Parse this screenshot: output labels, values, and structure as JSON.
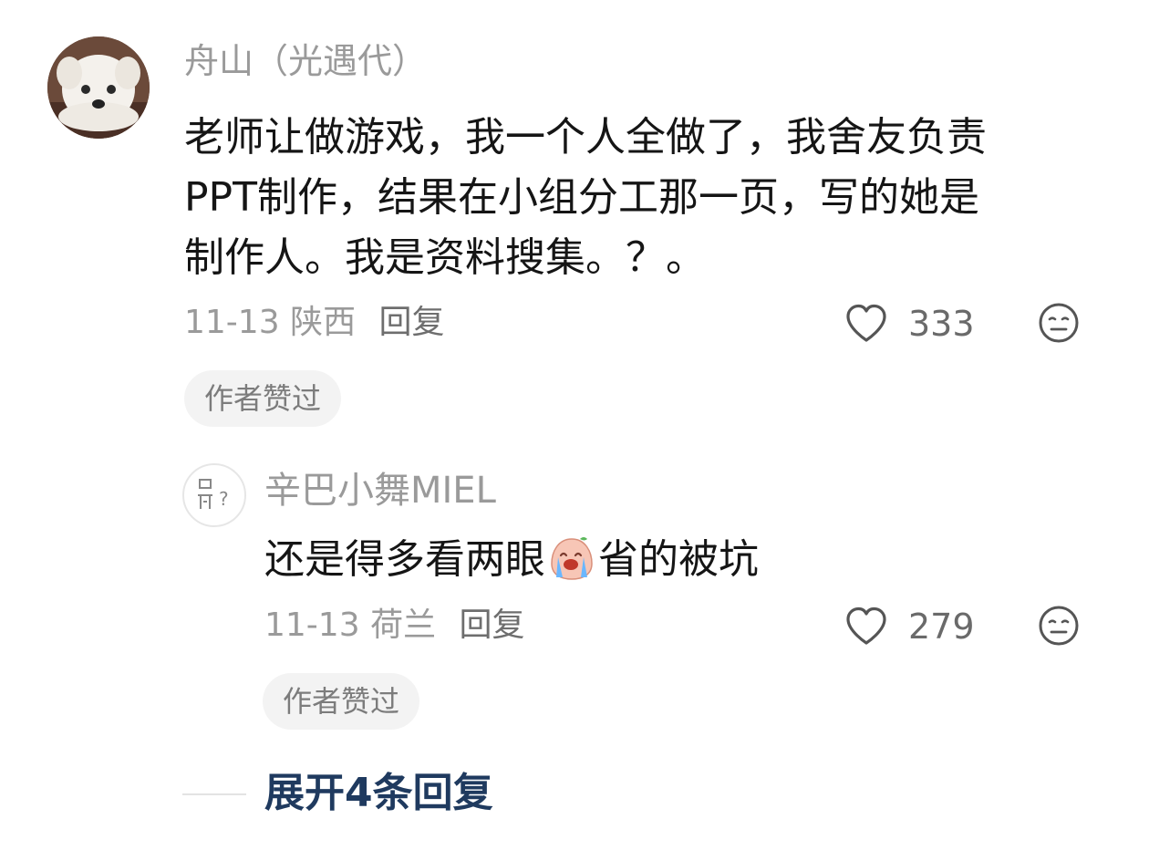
{
  "comment": {
    "username": "舟山（光遇代）",
    "text": "老师让做游戏，我一个人全做了，我舍友负责PPT制作，结果在小组分工那一页，写的她是制作人。我是资料搜集。？。",
    "lines": [
      "老师让做游戏，我一个人全做了，我舍友负责",
      "PPT制作，结果在小组分工那一页，写的她是",
      "制作人。我是资料搜集。？。"
    ],
    "date": "11-13",
    "location": "陕西",
    "reply_label": "回复",
    "likes": "333",
    "author_badge": "作者赞过"
  },
  "reply": {
    "username": "辛巴小舞MIEL",
    "text_before": "还是得多看两眼",
    "emoji": "crying-face-emoji",
    "text_after": "省的被坑",
    "date": "11-13",
    "location": "荷兰",
    "reply_label": "回复",
    "likes": "279",
    "author_badge": "作者赞过"
  },
  "expand": {
    "label": "展开4条回复"
  },
  "icons": {
    "like": "heart-outline-icon",
    "dislike": "neutral-face-icon",
    "avatar_placeholder": "question-person-icon"
  },
  "colors": {
    "link": "#1f3a5f",
    "secondary_text": "#9a9a9a",
    "badge_bg": "#f3f3f3"
  }
}
